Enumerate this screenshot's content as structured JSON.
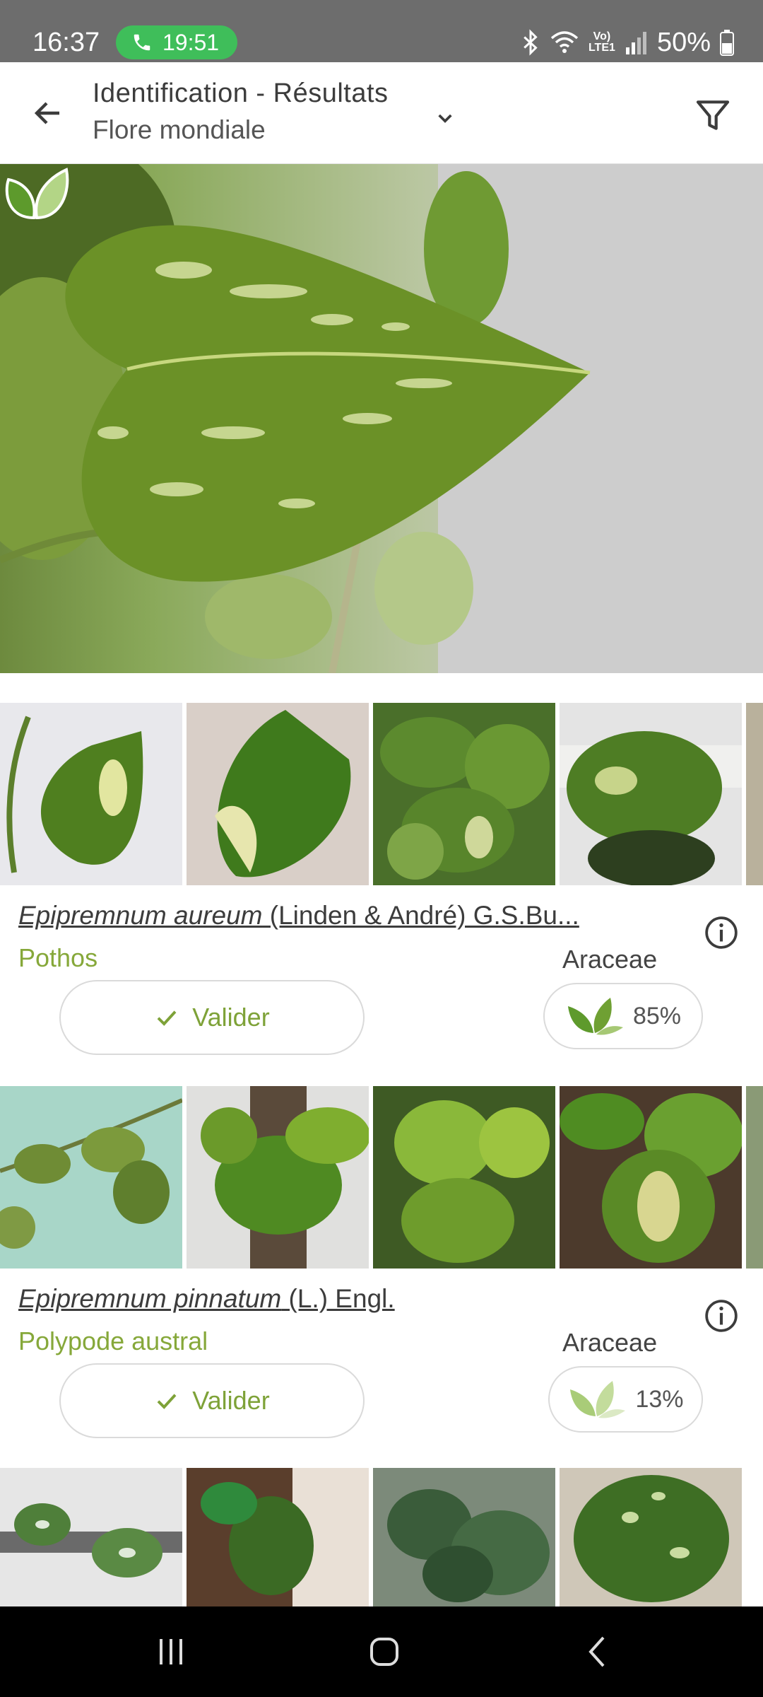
{
  "status_bar": {
    "time": "16:37",
    "call_timer": "19:51",
    "network_label": "Vo) LTE1",
    "battery": "50%"
  },
  "app_bar": {
    "title": "Identification - Résultats",
    "subtitle": "Flore mondiale",
    "icons": [
      "back-arrow-icon",
      "chevron-down-icon",
      "filter-icon"
    ]
  },
  "results": [
    {
      "genus_species": "Epipremnum aureum",
      "author": " (Linden & André) G.S.Bu...",
      "common_name": "Pothos",
      "family": "Araceae",
      "validate_label": "Valider",
      "score": "85%",
      "score_value": 0.85,
      "score_color": "#6fa033"
    },
    {
      "genus_species": "Epipremnum pinnatum",
      "author": " (L.) Engl.",
      "common_name": "Polypode austral",
      "family": "Araceae",
      "validate_label": "Valider",
      "score": "13%",
      "score_value": 0.13,
      "score_color": "#b7d386"
    }
  ],
  "colors": {
    "accent_green": "#86a83a",
    "status_bar": "#6d6d6d",
    "call_pill": "#3fbe5a",
    "nav_bar": "#000000"
  }
}
